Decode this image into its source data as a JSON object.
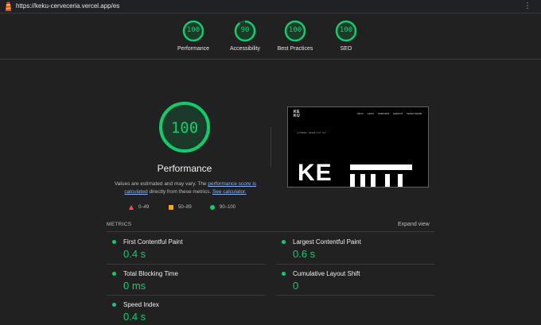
{
  "url": "https://keku-cerveceria.vercel.app/es",
  "menu_icon": "⋮",
  "accent_color": "#0cce6b",
  "summary": [
    {
      "score": "100",
      "label": "Performance"
    },
    {
      "score": "90",
      "label": "Accessibility",
      "fraction": 0.9
    },
    {
      "score": "100",
      "label": "Best Practices"
    },
    {
      "score": "100",
      "label": "SEO"
    }
  ],
  "main": {
    "score": "100",
    "title": "Performance",
    "disclaimer": {
      "pre": "Values are estimated and may vary. The ",
      "link1": "performance score is calculated",
      "mid": " directly from these metrics. ",
      "link2": "See calculator."
    },
    "legend": [
      {
        "shape": "triangle",
        "range": "0–49"
      },
      {
        "shape": "square",
        "range": "50–89"
      },
      {
        "shape": "circle",
        "range": "90–100"
      }
    ]
  },
  "screenshot": {
    "logo_line1": "KE",
    "logo_line2": "KU",
    "nav": [
      "INICIO",
      "CARTA",
      "NOSOTROS",
      "EVENTOS",
      "TIENDA ONLINE"
    ],
    "subtitle": "● PORRES · DESDE 1776 · 10.6",
    "big_text": "KE"
  },
  "metrics": {
    "header": "METRICS",
    "expand_label": "Expand view",
    "items": [
      {
        "name": "First Contentful Paint",
        "value": "0.4 s"
      },
      {
        "name": "Largest Contentful Paint",
        "value": "0.6 s"
      },
      {
        "name": "Total Blocking Time",
        "value": "0 ms"
      },
      {
        "name": "Cumulative Layout Shift",
        "value": "0"
      },
      {
        "name": "Speed Index",
        "value": "0.4 s"
      }
    ]
  }
}
